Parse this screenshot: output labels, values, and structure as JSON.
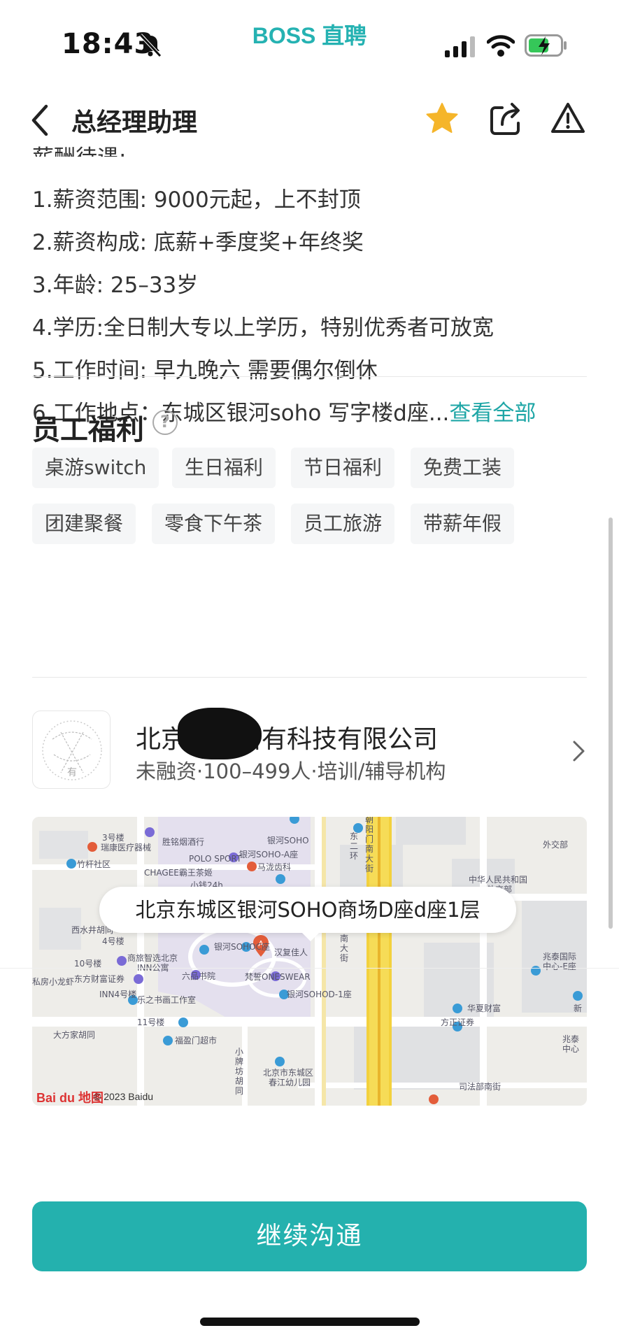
{
  "status_bar": {
    "time": "18:43",
    "brand": "BOSS 直聘",
    "icons": [
      "bell-slash-icon",
      "signal-icon",
      "wifi-icon",
      "battery-charging-icon"
    ]
  },
  "nav": {
    "title": "总经理助理",
    "icons": [
      "chevron-left-icon",
      "star-icon",
      "share-icon",
      "alert-icon"
    ],
    "star_color": "#f5b52a"
  },
  "description": {
    "heading_partial": "薪酬待遇:",
    "lines": [
      "1.薪资范围: 9000元起，上不封顶",
      "2.薪资构成: 底薪+季度奖+年终奖",
      "3.年龄: 25–33岁",
      "4.学历:全日制大专以上学历，特别优秀者可放宽",
      "5.工作时间: 早九晚六 需要偶尔倒休"
    ],
    "last_line": "6.工作地点：东城区银河soho 写字楼d座...",
    "more_label": "查看全部"
  },
  "benefits": {
    "title": "员工福利",
    "help_icon": "?",
    "tags": [
      "桌游switch",
      "生日福利",
      "节日福利",
      "免费工装",
      "团建聚餐",
      "零食下午茶",
      "员工旅游",
      "带薪年假"
    ]
  },
  "company": {
    "name": "北京左宜右有科技有限公司",
    "info": "未融资·100–499人·培训/辅导机构"
  },
  "map": {
    "address": "北京东城区银河SOHO商场D座d座1层",
    "logo_text": "Bai du 地图",
    "copyright": "© 2023 Baidu",
    "labels": [
      "3号楼",
      "INN",
      "胜铭烟酒行",
      "银河SOHO",
      "瑞康医疗器械",
      "竹杆社区",
      "POLO SPORT",
      "银河SOHO-A座",
      "CHAGEE霸王茶姬",
      "马泷齿科",
      "小钱24h",
      "西水井胡同",
      "4号楼",
      "10号楼",
      "商旅智选北京INN公寓",
      "银河SOHOC座",
      "汉复佳人",
      "东方财富证券",
      "六品书院",
      "梵誓ONESWEAR",
      "INN4号楼",
      "私房小龙虾",
      "乐之书画工作室",
      "银河SOHOD-1座",
      "11号楼",
      "大方家胡同",
      "福盈门超市",
      "北京市东城区春江幼儿园",
      "小牌坊胡同",
      "朝阳门南大街",
      "东二环",
      "外交部",
      "中华人民共和国外交部",
      "兆泰国际中心-E座",
      "华夏财富",
      "方正证券",
      "新",
      "兆泰国际中心",
      "司法部南街",
      "东二环",
      "朝阳门南大街"
    ]
  },
  "cta": {
    "label": "继续沟通",
    "color": "#24b1ae"
  }
}
